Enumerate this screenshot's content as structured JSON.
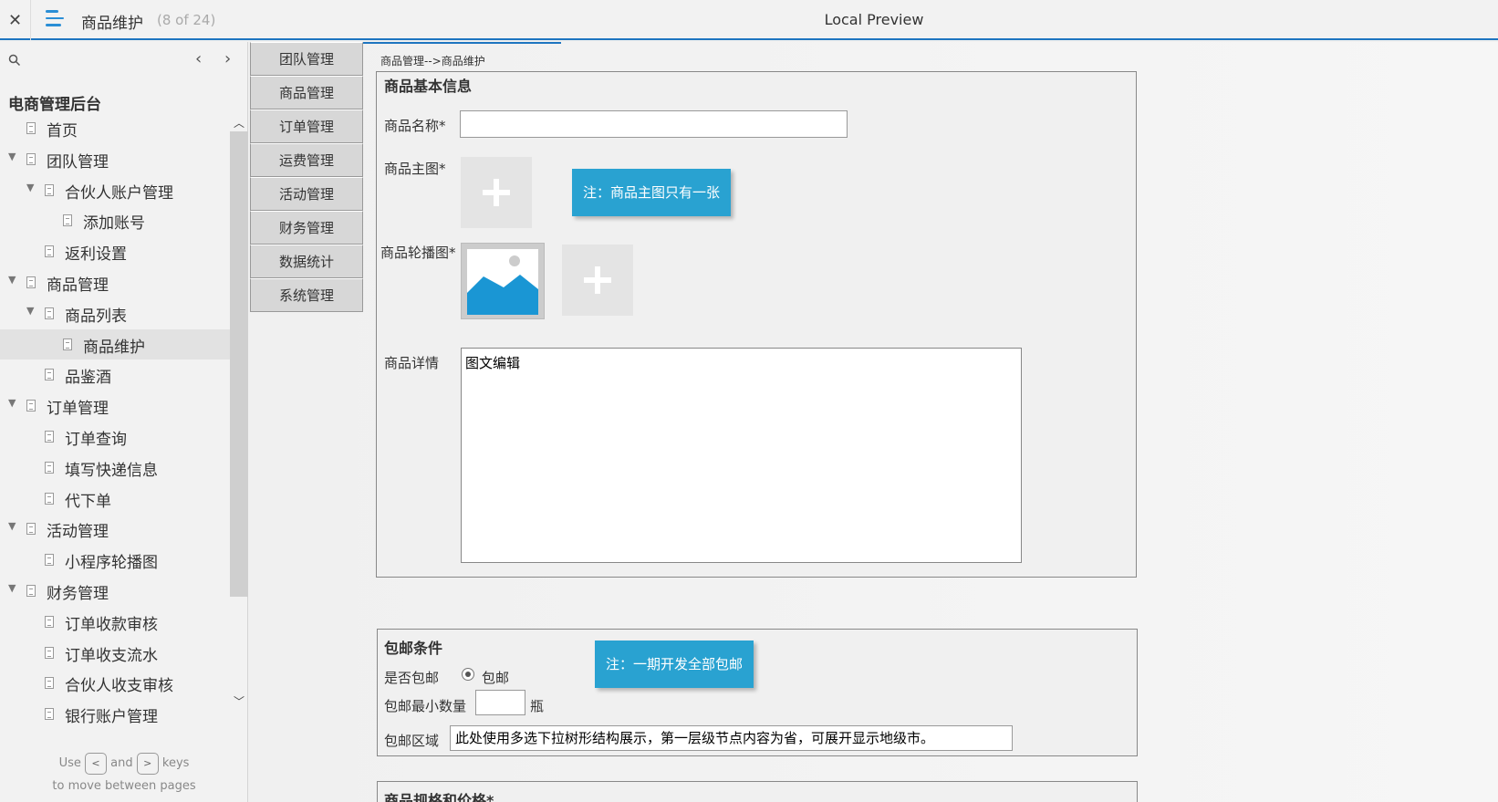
{
  "topbar": {
    "close_glyph": "✕",
    "page_title": "商品维护",
    "page_count": "(8 of 24)",
    "preview_title": "Local Preview"
  },
  "sidebar": {
    "prev_glyph": "‹",
    "next_glyph": "›",
    "root_label": "电商管理后台",
    "items": [
      {
        "label": "首页",
        "depth": 0,
        "expandable": false,
        "selected": false
      },
      {
        "label": "团队管理",
        "depth": 0,
        "expandable": true,
        "selected": false
      },
      {
        "label": "合伙人账户管理",
        "depth": 1,
        "expandable": true,
        "selected": false
      },
      {
        "label": "添加账号",
        "depth": 2,
        "expandable": false,
        "selected": false
      },
      {
        "label": "返利设置",
        "depth": 1,
        "expandable": false,
        "selected": false
      },
      {
        "label": "商品管理",
        "depth": 0,
        "expandable": true,
        "selected": false
      },
      {
        "label": "商品列表",
        "depth": 1,
        "expandable": true,
        "selected": false
      },
      {
        "label": "商品维护",
        "depth": 2,
        "expandable": false,
        "selected": true
      },
      {
        "label": "品鉴酒",
        "depth": 1,
        "expandable": false,
        "selected": false
      },
      {
        "label": "订单管理",
        "depth": 0,
        "expandable": true,
        "selected": false
      },
      {
        "label": "订单查询",
        "depth": 1,
        "expandable": false,
        "selected": false
      },
      {
        "label": "填写快递信息",
        "depth": 1,
        "expandable": false,
        "selected": false
      },
      {
        "label": "代下单",
        "depth": 1,
        "expandable": false,
        "selected": false
      },
      {
        "label": "活动管理",
        "depth": 0,
        "expandable": true,
        "selected": false
      },
      {
        "label": "小程序轮播图",
        "depth": 1,
        "expandable": false,
        "selected": false
      },
      {
        "label": "财务管理",
        "depth": 0,
        "expandable": true,
        "selected": false
      },
      {
        "label": "订单收款审核",
        "depth": 1,
        "expandable": false,
        "selected": false
      },
      {
        "label": "订单收支流水",
        "depth": 1,
        "expandable": false,
        "selected": false
      },
      {
        "label": "合伙人收支审核",
        "depth": 1,
        "expandable": false,
        "selected": false
      },
      {
        "label": "银行账户管理",
        "depth": 1,
        "expandable": false,
        "selected": false
      }
    ],
    "hint": {
      "use": "Use",
      "key_prev": "<",
      "and": "and",
      "key_next": ">",
      "keys": "keys",
      "line2": "to move between pages"
    }
  },
  "proto": {
    "menu": [
      "团队管理",
      "商品管理",
      "订单管理",
      "运费管理",
      "活动管理",
      "财务管理",
      "数据统计",
      "系统管理"
    ],
    "breadcrumb": "商品管理-->商品维护",
    "basic": {
      "title": "商品基本信息",
      "name_label": "商品名称*",
      "name_value": "",
      "main_image_label": "商品主图*",
      "main_image_note": "注：商品主图只有一张",
      "carousel_label": "商品轮播图*",
      "detail_label": "商品详情",
      "detail_value": "图文编辑"
    },
    "shipping": {
      "title": "包邮条件",
      "free_label": "是否包邮",
      "free_option": "包邮",
      "free_selected": true,
      "note": "注：一期开发全部包邮",
      "min_qty_label": "包邮最小数量",
      "min_qty_value": "",
      "unit": "瓶",
      "region_label": "包邮区域",
      "region_value": "此处使用多选下拉树形结构展示，第一层级节点内容为省，可展开显示地级市。"
    },
    "spec": {
      "title": "商品规格和价格*"
    }
  },
  "colors": {
    "accent": "#1e75c0",
    "note_bg": "#29a2d1",
    "image_blue": "#1a96d4"
  }
}
